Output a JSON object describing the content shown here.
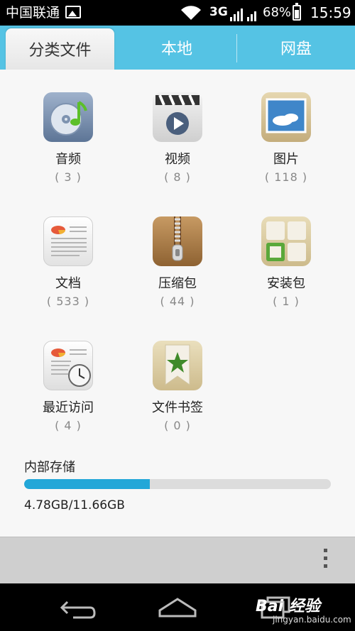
{
  "status_bar": {
    "carrier": "中国联通",
    "network": "3G",
    "battery_percent": "68%",
    "battery_level": 0.68,
    "time": "15:59",
    "icons": [
      "image-notification-icon",
      "wifi-icon",
      "signal-icon",
      "battery-icon"
    ]
  },
  "tabs": [
    {
      "label": "分类文件",
      "active": true
    },
    {
      "label": "本地",
      "active": false
    },
    {
      "label": "网盘",
      "active": false
    }
  ],
  "categories": [
    {
      "label": "音频",
      "count": "( 3 )",
      "icon": "audio-icon"
    },
    {
      "label": "视频",
      "count": "( 8 )",
      "icon": "video-icon"
    },
    {
      "label": "图片",
      "count": "( 118 )",
      "icon": "image-icon"
    },
    {
      "label": "文档",
      "count": "( 533 )",
      "icon": "document-icon"
    },
    {
      "label": "压缩包",
      "count": "( 44 )",
      "icon": "zip-icon"
    },
    {
      "label": "安装包",
      "count": "( 1 )",
      "icon": "apk-icon"
    },
    {
      "label": "最近访问",
      "count": "( 4 )",
      "icon": "recent-icon"
    },
    {
      "label": "文件书签",
      "count": "( 0 )",
      "icon": "bookmark-icon"
    }
  ],
  "storage": {
    "label": "内部存储",
    "value": "4.78GB/11.66GB",
    "used_fraction": 0.41
  },
  "colors": {
    "accent": "#55c3e4",
    "progress": "#23a7d8"
  },
  "watermark": {
    "text": "Bai 经验",
    "sub": "jingyan.baidu.com"
  }
}
